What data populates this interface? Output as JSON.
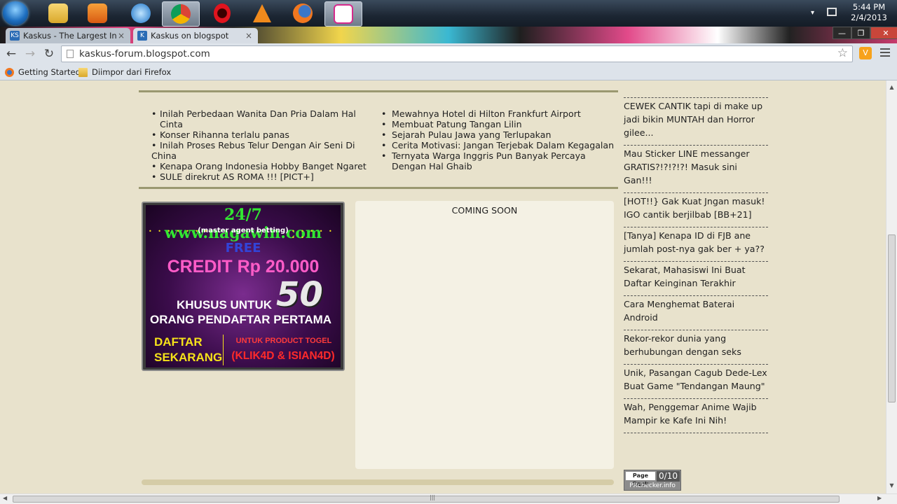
{
  "taskbar": {
    "clock_time": "5:44 PM",
    "clock_date": "2/4/2013",
    "tray_arrow": "▾"
  },
  "tabs": [
    {
      "label": "Kaskus - The Largest Indo",
      "close": "×",
      "favicon": "KS"
    },
    {
      "label": "Kaskus on blogspot",
      "close": "×",
      "favicon": "K"
    }
  ],
  "window_buttons": {
    "minimize": "—",
    "restore": "❐",
    "close": "✕"
  },
  "toolbar": {
    "back": "←",
    "forward": "→",
    "reload": "↻",
    "url": "kaskus-forum.blogspot.com",
    "star": "☆",
    "ext": "V"
  },
  "bookmarks": [
    {
      "label": "Getting Started"
    },
    {
      "label": "Diimpor dari Firefox"
    }
  ],
  "links_left": [
    "Inilah Perbedaan Wanita Dan Pria Dalam Hal Cinta",
    "Konser Rihanna terlalu panas",
    "Inilah Proses Rebus Telur Dengan Air Seni Di China",
    "Kenapa Orang Indonesia Hobby Banget Ngaret",
    "SULE direkrut AS ROMA !!! [PICT+]"
  ],
  "links_right": [
    "Mewahnya Hotel di Hilton Frankfurt Airport",
    "Membuat Patung Tangan Lilin",
    "Sejarah Pulau Jawa yang Terlupakan",
    "Cerita Motivasi: Jangan Terjebak Dalam Kegagalan",
    "Ternyata Warga Inggris Pun Banyak Percaya Dengan Hal Ghaib"
  ],
  "bullet": "•",
  "ad": {
    "url": "24/7 www.nagawin.com",
    "dots": "• • • • • • •",
    "subtitle": "(master agent betting)",
    "free": "FREE",
    "credit": "CREDIT Rp 20.000",
    "big_number": "50",
    "khusus": "KHUSUS UNTUK",
    "orang": "ORANG PENDAFTAR PERTAMA",
    "daftar_1": "DAFTAR",
    "daftar_2": "SEKARANG",
    "product": "UNTUK PRODUCT TOGEL",
    "klik": "(KLIK4D & ISIAN4D)"
  },
  "coming_soon": "COMING SOON",
  "sidebar_links": [
    "CEWEK CANTIK tapi di make up jadi bikin MUNTAH dan Horror gilee...",
    "Mau Sticker LINE messanger GRATIS?!?!?!?! Masuk sini Gan!!!",
    "[HOT!!} Gak Kuat Jngan masuk! IGO cantik berjilbab [BB+21]",
    "[Tanya] Kenapa ID di FJB ane jumlah post-nya gak ber + ya??",
    "Sekarat, Mahasiswi Ini Buat Daftar Keinginan Terakhir",
    "Cara Menghemat Baterai Android",
    "Rekor-rekor dunia yang berhubungan dengan seks",
    "Unik, Pasangan Cagub Dede-Lex Buat Game \"Tendangan Maung\"",
    "Wah, Penggemar Anime Wajib Mampir ke Kafe Ini Nih!"
  ],
  "pagerank": {
    "label": "Page Rank",
    "value": "0/10",
    "site": "PRchecker.info"
  },
  "scroll": {
    "up": "▲",
    "down": "▼",
    "left": "◀",
    "right": "▶",
    "grip": "|||"
  },
  "colors": {
    "page_bg": "#e8e2cc",
    "divider": "#9a9870",
    "ad_green": "#32e632",
    "ad_pink": "#ff5cc8"
  }
}
